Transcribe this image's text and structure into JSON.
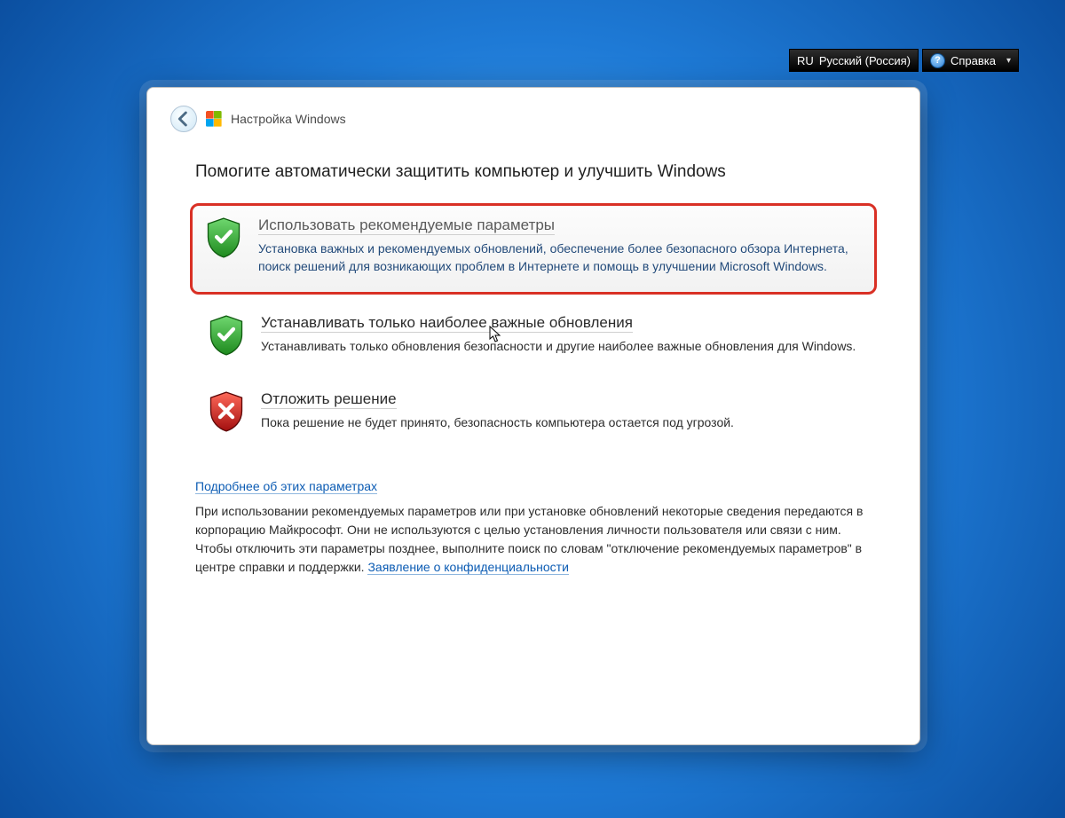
{
  "topbar": {
    "language_code": "RU",
    "language_label": "Русский (Россия)",
    "help_label": "Справка"
  },
  "window": {
    "title": "Настройка Windows",
    "heading": "Помогите автоматически защитить компьютер и улучшить Windows"
  },
  "options": {
    "recommended": {
      "title": "Использовать рекомендуемые параметры",
      "desc": "Установка важных и рекомендуемых обновлений, обеспечение более безопасного обзора Интернета, поиск решений для возникающих проблем в Интернете и помощь в улучшении Microsoft Windows."
    },
    "important_only": {
      "title": "Устанавливать только наиболее важные обновления",
      "desc": "Устанавливать только обновления безопасности и другие наиболее важные обновления для Windows."
    },
    "postpone": {
      "title": "Отложить решение",
      "desc": "Пока решение не будет принято, безопасность компьютера остается под угрозой."
    }
  },
  "footer": {
    "learn_more": "Подробнее об этих параметрах",
    "info_text_1": "При использовании рекомендуемых параметров или при установке обновлений некоторые сведения передаются в корпорацию Майкрософт. Они не используются с целью установления личности пользователя или связи с ним. Чтобы отключить эти параметры позднее, выполните поиск по словам \"отключение рекомендуемых параметров\" в центре справки и поддержки. ",
    "privacy_link": "Заявление о конфиденциальности"
  },
  "icons": {
    "shield_green": "shield-check-green",
    "shield_red": "shield-x-red"
  }
}
